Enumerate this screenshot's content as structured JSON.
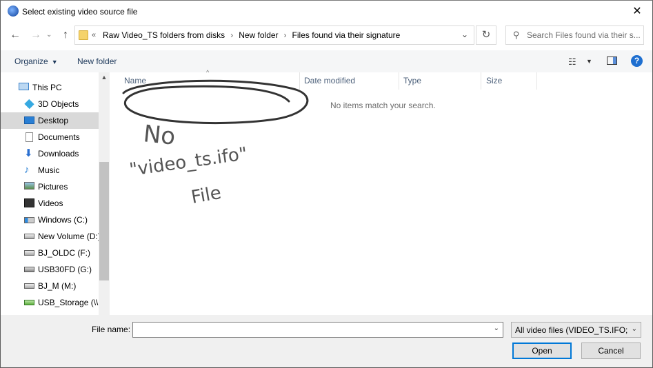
{
  "window": {
    "title": "Select existing video source file",
    "close_glyph": "✕"
  },
  "nav_buttons": {
    "back": "←",
    "forward": "→",
    "recent": "⌄",
    "up": "↑"
  },
  "address": {
    "prefix": "«",
    "crumbs": [
      "Raw Video_TS folders from disks",
      "New folder",
      "Files found via their signature"
    ],
    "separator": "›",
    "dropdown": "⌄",
    "refresh": "↻"
  },
  "search": {
    "placeholder": "Search Files found via their s..."
  },
  "toolbar": {
    "organize": "Organize",
    "organize_caret": "▼",
    "new_folder": "New folder",
    "view_icon": "☷",
    "view_caret": "▼",
    "help": "?"
  },
  "sidebar": {
    "items": [
      {
        "label": "This PC",
        "icon": "computer-icon"
      },
      {
        "label": "3D Objects",
        "icon": "cube-icon"
      },
      {
        "label": "Desktop",
        "icon": "desktop-icon",
        "selected": true
      },
      {
        "label": "Documents",
        "icon": "document-icon"
      },
      {
        "label": "Downloads",
        "icon": "download-icon"
      },
      {
        "label": "Music",
        "icon": "music-icon"
      },
      {
        "label": "Pictures",
        "icon": "picture-icon"
      },
      {
        "label": "Videos",
        "icon": "video-icon"
      },
      {
        "label": "Windows (C:)",
        "icon": "windows-drive-icon"
      },
      {
        "label": "New Volume (D:)",
        "icon": "drive-icon"
      },
      {
        "label": "BJ_OLDC (F:)",
        "icon": "drive-icon"
      },
      {
        "label": "USB30FD (G:)",
        "icon": "usb-drive-icon"
      },
      {
        "label": "BJ_M (M:)",
        "icon": "drive-icon"
      },
      {
        "label": "USB_Storage (\\\\F",
        "icon": "network-drive-icon"
      }
    ],
    "scroll_up": "▲"
  },
  "filelist": {
    "columns": [
      "Name",
      "Date modified",
      "Type",
      "Size"
    ],
    "sort_indicator": "^",
    "empty_message": "No items match your search.",
    "annotation_lines": [
      "No",
      "\"video_ts.ifo\"",
      "File"
    ]
  },
  "bottom": {
    "file_name_label": "File name:",
    "file_name_value": "",
    "file_name_dropdown": "⌄",
    "filter": "All video files  (VIDEO_TS.IFO;DI",
    "filter_dropdown": "⌄",
    "open": "Open",
    "cancel": "Cancel"
  },
  "colors": {
    "accent": "#0078d7",
    "selected_bg": "#d9d9d9",
    "header_text": "#4c607a"
  }
}
